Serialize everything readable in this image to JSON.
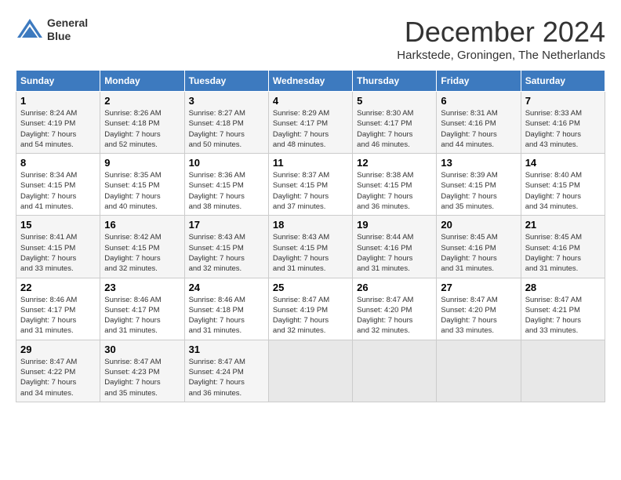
{
  "header": {
    "logo_line1": "General",
    "logo_line2": "Blue",
    "month_title": "December 2024",
    "subtitle": "Harkstede, Groningen, The Netherlands"
  },
  "columns": [
    "Sunday",
    "Monday",
    "Tuesday",
    "Wednesday",
    "Thursday",
    "Friday",
    "Saturday"
  ],
  "weeks": [
    [
      {
        "day": "1",
        "info": "Sunrise: 8:24 AM\nSunset: 4:19 PM\nDaylight: 7 hours\nand 54 minutes."
      },
      {
        "day": "2",
        "info": "Sunrise: 8:26 AM\nSunset: 4:18 PM\nDaylight: 7 hours\nand 52 minutes."
      },
      {
        "day": "3",
        "info": "Sunrise: 8:27 AM\nSunset: 4:18 PM\nDaylight: 7 hours\nand 50 minutes."
      },
      {
        "day": "4",
        "info": "Sunrise: 8:29 AM\nSunset: 4:17 PM\nDaylight: 7 hours\nand 48 minutes."
      },
      {
        "day": "5",
        "info": "Sunrise: 8:30 AM\nSunset: 4:17 PM\nDaylight: 7 hours\nand 46 minutes."
      },
      {
        "day": "6",
        "info": "Sunrise: 8:31 AM\nSunset: 4:16 PM\nDaylight: 7 hours\nand 44 minutes."
      },
      {
        "day": "7",
        "info": "Sunrise: 8:33 AM\nSunset: 4:16 PM\nDaylight: 7 hours\nand 43 minutes."
      }
    ],
    [
      {
        "day": "8",
        "info": "Sunrise: 8:34 AM\nSunset: 4:15 PM\nDaylight: 7 hours\nand 41 minutes."
      },
      {
        "day": "9",
        "info": "Sunrise: 8:35 AM\nSunset: 4:15 PM\nDaylight: 7 hours\nand 40 minutes."
      },
      {
        "day": "10",
        "info": "Sunrise: 8:36 AM\nSunset: 4:15 PM\nDaylight: 7 hours\nand 38 minutes."
      },
      {
        "day": "11",
        "info": "Sunrise: 8:37 AM\nSunset: 4:15 PM\nDaylight: 7 hours\nand 37 minutes."
      },
      {
        "day": "12",
        "info": "Sunrise: 8:38 AM\nSunset: 4:15 PM\nDaylight: 7 hours\nand 36 minutes."
      },
      {
        "day": "13",
        "info": "Sunrise: 8:39 AM\nSunset: 4:15 PM\nDaylight: 7 hours\nand 35 minutes."
      },
      {
        "day": "14",
        "info": "Sunrise: 8:40 AM\nSunset: 4:15 PM\nDaylight: 7 hours\nand 34 minutes."
      }
    ],
    [
      {
        "day": "15",
        "info": "Sunrise: 8:41 AM\nSunset: 4:15 PM\nDaylight: 7 hours\nand 33 minutes."
      },
      {
        "day": "16",
        "info": "Sunrise: 8:42 AM\nSunset: 4:15 PM\nDaylight: 7 hours\nand 32 minutes."
      },
      {
        "day": "17",
        "info": "Sunrise: 8:43 AM\nSunset: 4:15 PM\nDaylight: 7 hours\nand 32 minutes."
      },
      {
        "day": "18",
        "info": "Sunrise: 8:43 AM\nSunset: 4:15 PM\nDaylight: 7 hours\nand 31 minutes."
      },
      {
        "day": "19",
        "info": "Sunrise: 8:44 AM\nSunset: 4:16 PM\nDaylight: 7 hours\nand 31 minutes."
      },
      {
        "day": "20",
        "info": "Sunrise: 8:45 AM\nSunset: 4:16 PM\nDaylight: 7 hours\nand 31 minutes."
      },
      {
        "day": "21",
        "info": "Sunrise: 8:45 AM\nSunset: 4:16 PM\nDaylight: 7 hours\nand 31 minutes."
      }
    ],
    [
      {
        "day": "22",
        "info": "Sunrise: 8:46 AM\nSunset: 4:17 PM\nDaylight: 7 hours\nand 31 minutes."
      },
      {
        "day": "23",
        "info": "Sunrise: 8:46 AM\nSunset: 4:17 PM\nDaylight: 7 hours\nand 31 minutes."
      },
      {
        "day": "24",
        "info": "Sunrise: 8:46 AM\nSunset: 4:18 PM\nDaylight: 7 hours\nand 31 minutes."
      },
      {
        "day": "25",
        "info": "Sunrise: 8:47 AM\nSunset: 4:19 PM\nDaylight: 7 hours\nand 32 minutes."
      },
      {
        "day": "26",
        "info": "Sunrise: 8:47 AM\nSunset: 4:20 PM\nDaylight: 7 hours\nand 32 minutes."
      },
      {
        "day": "27",
        "info": "Sunrise: 8:47 AM\nSunset: 4:20 PM\nDaylight: 7 hours\nand 33 minutes."
      },
      {
        "day": "28",
        "info": "Sunrise: 8:47 AM\nSunset: 4:21 PM\nDaylight: 7 hours\nand 33 minutes."
      }
    ],
    [
      {
        "day": "29",
        "info": "Sunrise: 8:47 AM\nSunset: 4:22 PM\nDaylight: 7 hours\nand 34 minutes."
      },
      {
        "day": "30",
        "info": "Sunrise: 8:47 AM\nSunset: 4:23 PM\nDaylight: 7 hours\nand 35 minutes."
      },
      {
        "day": "31",
        "info": "Sunrise: 8:47 AM\nSunset: 4:24 PM\nDaylight: 7 hours\nand 36 minutes."
      },
      {
        "day": "",
        "info": ""
      },
      {
        "day": "",
        "info": ""
      },
      {
        "day": "",
        "info": ""
      },
      {
        "day": "",
        "info": ""
      }
    ]
  ]
}
